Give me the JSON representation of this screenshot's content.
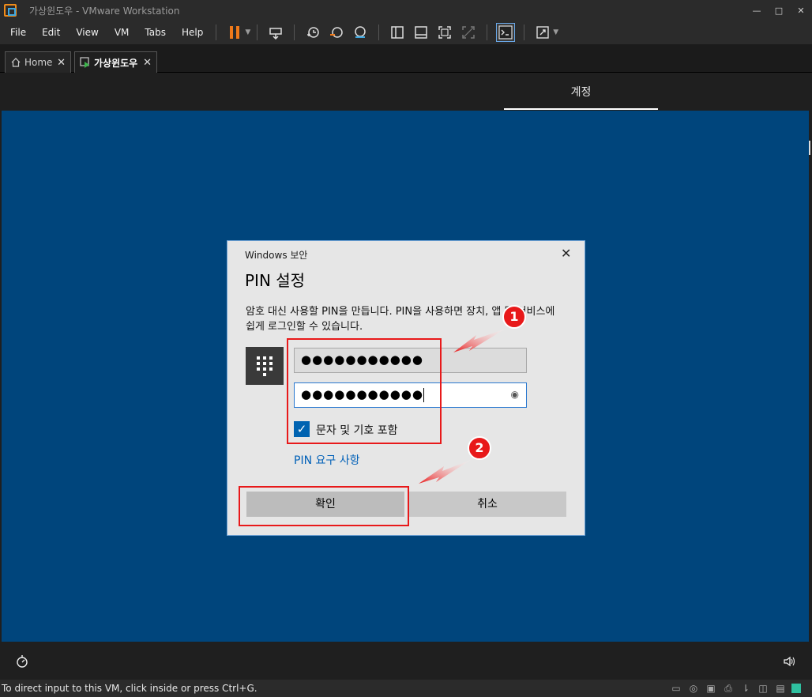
{
  "window": {
    "title": "가상윈도우 - VMware Workstation",
    "controls": {
      "minimize": "—",
      "maximize": "□",
      "close": "✕"
    }
  },
  "menu": {
    "items": [
      "File",
      "Edit",
      "View",
      "VM",
      "Tabs",
      "Help"
    ]
  },
  "toolbar": {
    "icons": [
      "pause-icon",
      "send-ctrl-alt-del-icon",
      "snapshot-icon",
      "revert-snapshot-icon",
      "snapshot-manager-icon",
      "show-library-icon",
      "show-thumbnail-bar-icon",
      "fullscreen-icon",
      "unity-icon",
      "console-view-icon",
      "stretch-guest-icon"
    ],
    "accent": "#f07a1a"
  },
  "tabs": [
    {
      "label": "Home",
      "close": "✕"
    },
    {
      "label": "가상윈도우",
      "close": "✕"
    }
  ],
  "vm_header": {
    "title": "계정"
  },
  "dialog": {
    "caption": "Windows 보안",
    "close": "✕",
    "heading": "PIN 설정",
    "description": "암호 대신 사용할 PIN을 만듭니다. PIN을 사용하면 장치, 앱 및 서비스에 쉽게 로그인할 수 있습니다.",
    "new_pin_value": "●●●●●●●●●●●",
    "confirm_pin_value": "●●●●●●●●●●●",
    "checkbox_label": "문자 및 기호 포함",
    "checkbox_checked": true,
    "requirements_link": "PIN 요구 사항",
    "ok_label": "확인",
    "cancel_label": "취소"
  },
  "annotations": {
    "badge_1": "1",
    "badge_2": "2",
    "color": "#e8191a"
  },
  "statusbar": {
    "text": "To direct input to this VM, click inside or press Ctrl+G."
  },
  "colors": {
    "vm_background": "#00457c",
    "dialog_background": "#e6e6e6",
    "link": "#0060b8",
    "checkbox": "#0063b1"
  }
}
